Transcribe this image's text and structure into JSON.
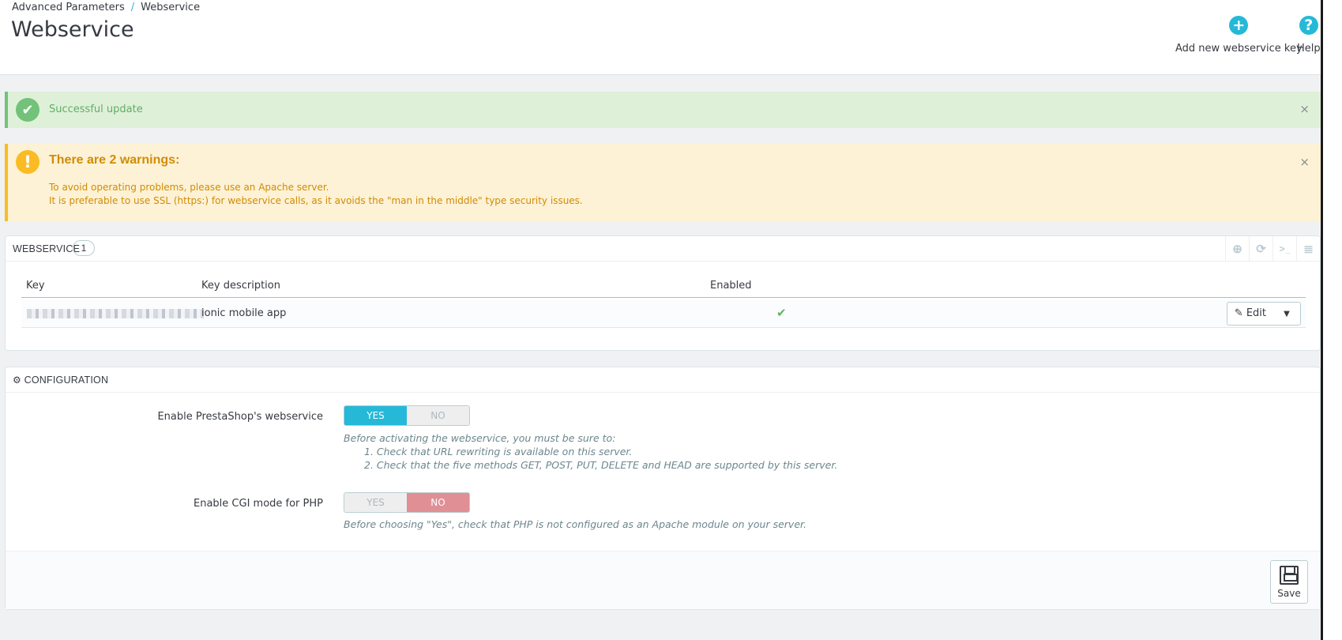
{
  "header": {
    "breadcrumb": [
      "Advanced Parameters",
      "Webservice"
    ],
    "breadcrumb_sep": "/",
    "title": "Webservice",
    "add_key_label": "Add new webservice key",
    "help_label": "Help"
  },
  "alerts": {
    "success": {
      "text": "Successful update",
      "close": "×"
    },
    "warning": {
      "title": "There are 2 warnings:",
      "lines": [
        "To avoid operating problems, please use an Apache server.",
        "It is preferable to use SSL (https:) for webservice calls, as it avoids the \"man in the middle\" type security issues."
      ],
      "close": "×"
    }
  },
  "webservice_panel": {
    "title": "WEBSERVICE",
    "count": "1",
    "columns": [
      "Key",
      "Key description",
      "Enabled"
    ],
    "rows": [
      {
        "description": "ionic mobile app",
        "enabled": "✔",
        "edit_label": "Edit"
      }
    ]
  },
  "config_panel": {
    "title": "CONFIGURATION",
    "fields": [
      {
        "label": "Enable PrestaShop's webservice",
        "yes": "YES",
        "no": "NO",
        "selected": "YES",
        "help": [
          "Before activating the webservice, you must be sure to:",
          "1. Check that URL rewriting is available on this server.",
          "2. Check that the five methods GET, POST, PUT, DELETE and HEAD are supported by this server."
        ]
      },
      {
        "label": "Enable CGI mode for PHP",
        "yes": "YES",
        "no": "NO",
        "selected": "NO",
        "help": [
          "Before choosing \"Yes\", check that PHP is not configured as an Apache module on your server."
        ]
      }
    ],
    "save_label": "Save"
  },
  "icons": {
    "add": "plus-circle-icon",
    "help": "question-circle-icon",
    "success": "check-circle-icon",
    "warning": "exclamation-circle-icon",
    "config": "cogs-icon",
    "save": "floppy-disk-icon"
  },
  "colors": {
    "accent": "#25b9d7",
    "success": "#72c279",
    "warning": "#fbbb22",
    "danger_switch": "#e08f95"
  }
}
